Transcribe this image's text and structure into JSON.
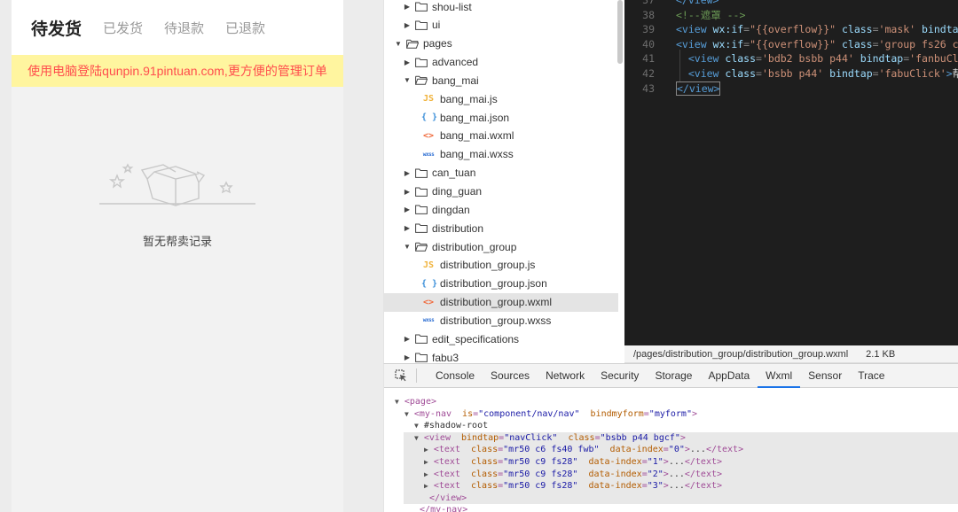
{
  "phone": {
    "tabs": [
      {
        "label": "待发货",
        "active": true
      },
      {
        "label": "已发货",
        "active": false
      },
      {
        "label": "待退款",
        "active": false
      },
      {
        "label": "已退款",
        "active": false
      }
    ],
    "notice": "使用电脑登陆qunpin.91pintuan.com,更方便的管理订单",
    "empty_text": "暂无帮卖记录"
  },
  "tree": {
    "items": [
      {
        "label": "shou-list",
        "type": "folder",
        "open": false,
        "depth": 1
      },
      {
        "label": "ui",
        "type": "folder",
        "open": false,
        "depth": 1
      },
      {
        "label": "pages",
        "type": "folder",
        "open": true,
        "depth": 0
      },
      {
        "label": "advanced",
        "type": "folder",
        "open": false,
        "depth": 1
      },
      {
        "label": "bang_mai",
        "type": "folder",
        "open": true,
        "depth": 1
      },
      {
        "label": "bang_mai.js",
        "type": "js",
        "depth": 2
      },
      {
        "label": "bang_mai.json",
        "type": "json",
        "depth": 2
      },
      {
        "label": "bang_mai.wxml",
        "type": "wxml",
        "depth": 2
      },
      {
        "label": "bang_mai.wxss",
        "type": "wxss",
        "depth": 2
      },
      {
        "label": "can_tuan",
        "type": "folder",
        "open": false,
        "depth": 1
      },
      {
        "label": "ding_guan",
        "type": "folder",
        "open": false,
        "depth": 1
      },
      {
        "label": "dingdan",
        "type": "folder",
        "open": false,
        "depth": 1
      },
      {
        "label": "distribution",
        "type": "folder",
        "open": false,
        "depth": 1
      },
      {
        "label": "distribution_group",
        "type": "folder",
        "open": true,
        "depth": 1
      },
      {
        "label": "distribution_group.js",
        "type": "js",
        "depth": 2
      },
      {
        "label": "distribution_group.json",
        "type": "json",
        "depth": 2
      },
      {
        "label": "distribution_group.wxml",
        "type": "wxml",
        "depth": 2,
        "selected": true
      },
      {
        "label": "distribution_group.wxss",
        "type": "wxss",
        "depth": 2
      },
      {
        "label": "edit_specifications",
        "type": "folder",
        "open": false,
        "depth": 1
      },
      {
        "label": "fabu3",
        "type": "folder",
        "open": false,
        "depth": 1
      }
    ],
    "icon_text": {
      "js": "JS",
      "json": "{ }",
      "wxml": "<>",
      "wxss": "wxss"
    }
  },
  "editor": {
    "lines": [
      {
        "num": "37",
        "tokens": [
          [
            "tag",
            "</view>"
          ]
        ]
      },
      {
        "num": "38",
        "tokens": [
          [
            "com",
            "<!--遮罩 -->"
          ]
        ]
      },
      {
        "num": "39",
        "tokens": [
          [
            "tag",
            "<view "
          ],
          [
            "attr",
            "wx:if"
          ],
          [
            "punc",
            "="
          ],
          [
            "str",
            "\"{{overflow}}\""
          ],
          [
            "plain",
            " "
          ],
          [
            "attr",
            "class"
          ],
          [
            "punc",
            "="
          ],
          [
            "str",
            "'mask'"
          ],
          [
            "plain",
            " "
          ],
          [
            "attr",
            "bindta"
          ]
        ]
      },
      {
        "num": "40",
        "tokens": [
          [
            "tag",
            "<view "
          ],
          [
            "attr",
            "wx:if"
          ],
          [
            "punc",
            "="
          ],
          [
            "str",
            "\"{{overflow}}\""
          ],
          [
            "plain",
            " "
          ],
          [
            "attr",
            "class"
          ],
          [
            "punc",
            "="
          ],
          [
            "str",
            "'group fs26 c"
          ]
        ]
      },
      {
        "num": "41",
        "tokens": [
          [
            "plain",
            "  "
          ],
          [
            "tag",
            "<view "
          ],
          [
            "attr",
            "class"
          ],
          [
            "punc",
            "="
          ],
          [
            "str",
            "'bdb2 bsbb p44'"
          ],
          [
            "plain",
            " "
          ],
          [
            "attr",
            "bindtap"
          ],
          [
            "punc",
            "="
          ],
          [
            "str",
            "'fanbuCl"
          ]
        ]
      },
      {
        "num": "42",
        "tokens": [
          [
            "plain",
            "  "
          ],
          [
            "tag",
            "<view "
          ],
          [
            "attr",
            "class"
          ],
          [
            "punc",
            "="
          ],
          [
            "str",
            "'bsbb p44'"
          ],
          [
            "plain",
            " "
          ],
          [
            "attr",
            "bindtap"
          ],
          [
            "punc",
            "="
          ],
          [
            "str",
            "'fabuClick'"
          ],
          [
            "tag",
            ">"
          ],
          [
            "plain",
            "帮"
          ]
        ]
      },
      {
        "num": "43",
        "tokens": [
          [
            "tag",
            "</view>"
          ]
        ]
      }
    ]
  },
  "status": {
    "path": "/pages/distribution_group/distribution_group.wxml",
    "size": "2.1 KB"
  },
  "devtools": {
    "tabs": [
      {
        "label": "Console",
        "active": false
      },
      {
        "label": "Sources",
        "active": false
      },
      {
        "label": "Network",
        "active": false
      },
      {
        "label": "Security",
        "active": false
      },
      {
        "label": "Storage",
        "active": false
      },
      {
        "label": "AppData",
        "active": false
      },
      {
        "label": "Wxml",
        "active": true
      },
      {
        "label": "Sensor",
        "active": false
      },
      {
        "label": "Trace",
        "active": false
      }
    ],
    "dom": [
      {
        "indent": 0,
        "tri": "▼",
        "tokens": [
          [
            "tag",
            "<page>"
          ]
        ]
      },
      {
        "indent": 1,
        "tri": "▼",
        "tokens": [
          [
            "tag",
            "<my-nav "
          ],
          [
            "attr",
            " is"
          ],
          [
            "tag",
            "="
          ],
          [
            "str",
            "\"component/nav/nav\""
          ],
          [
            "attr",
            "  bindmyform"
          ],
          [
            "tag",
            "="
          ],
          [
            "str",
            "\"myform\""
          ],
          [
            "tag",
            ">"
          ]
        ]
      },
      {
        "indent": 2,
        "tri": "▼",
        "tokens": [
          [
            "txt",
            "#shadow-root"
          ]
        ]
      },
      {
        "indent": 2,
        "tri": "▼",
        "hl": true,
        "tokens": [
          [
            "tag",
            "<view "
          ],
          [
            "attr",
            " bindtap"
          ],
          [
            "tag",
            "="
          ],
          [
            "str",
            "\"navClick\""
          ],
          [
            "attr",
            "  class"
          ],
          [
            "tag",
            "="
          ],
          [
            "str",
            "\"bsbb p44 bgcf\""
          ],
          [
            "tag",
            ">"
          ]
        ]
      },
      {
        "indent": 3,
        "tri": "▶",
        "hl": true,
        "tokens": [
          [
            "tag",
            "<text "
          ],
          [
            "attr",
            " class"
          ],
          [
            "tag",
            "="
          ],
          [
            "str",
            "\"mr50 c6 fs40 fwb\""
          ],
          [
            "attr",
            "  data-index"
          ],
          [
            "tag",
            "="
          ],
          [
            "str",
            "\"0\""
          ],
          [
            "tag",
            ">"
          ],
          [
            "txt",
            "..."
          ],
          [
            "tag",
            "</text>"
          ]
        ]
      },
      {
        "indent": 3,
        "tri": "▶",
        "hl": true,
        "tokens": [
          [
            "tag",
            "<text "
          ],
          [
            "attr",
            " class"
          ],
          [
            "tag",
            "="
          ],
          [
            "str",
            "\"mr50 c9 fs28\""
          ],
          [
            "attr",
            "  data-index"
          ],
          [
            "tag",
            "="
          ],
          [
            "str",
            "\"1\""
          ],
          [
            "tag",
            ">"
          ],
          [
            "txt",
            "..."
          ],
          [
            "tag",
            "</text>"
          ]
        ]
      },
      {
        "indent": 3,
        "tri": "▶",
        "hl": true,
        "tokens": [
          [
            "tag",
            "<text "
          ],
          [
            "attr",
            " class"
          ],
          [
            "tag",
            "="
          ],
          [
            "str",
            "\"mr50 c9 fs28\""
          ],
          [
            "attr",
            "  data-index"
          ],
          [
            "tag",
            "="
          ],
          [
            "str",
            "\"2\""
          ],
          [
            "tag",
            ">"
          ],
          [
            "txt",
            "..."
          ],
          [
            "tag",
            "</text>"
          ]
        ]
      },
      {
        "indent": 3,
        "tri": "▶",
        "hl": true,
        "tokens": [
          [
            "tag",
            "<text "
          ],
          [
            "attr",
            " class"
          ],
          [
            "tag",
            "="
          ],
          [
            "str",
            "\"mr50 c9 fs28\""
          ],
          [
            "attr",
            "  data-index"
          ],
          [
            "tag",
            "="
          ],
          [
            "str",
            "\"3\""
          ],
          [
            "tag",
            ">"
          ],
          [
            "txt",
            "..."
          ],
          [
            "tag",
            "</text>"
          ]
        ]
      },
      {
        "indent": 3,
        "tri": "",
        "hl": true,
        "tokens": [
          [
            "tag",
            "</view>"
          ]
        ]
      },
      {
        "indent": 2,
        "tri": "",
        "tokens": [
          [
            "tag",
            "</my-nav>"
          ]
        ]
      }
    ]
  }
}
